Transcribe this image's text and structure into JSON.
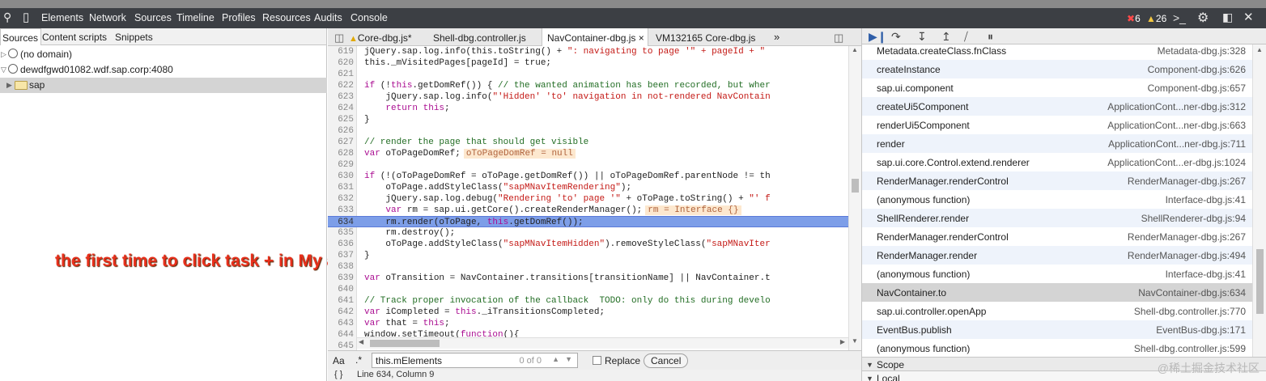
{
  "toolbar": {
    "tabs": [
      "Elements",
      "Network",
      "Sources",
      "Timeline",
      "Profiles",
      "Resources",
      "Audits",
      "Console"
    ],
    "error_count": "6",
    "warning_count": "26"
  },
  "left_panel": {
    "tabs": [
      "Sources",
      "Content scripts",
      "Snippets"
    ],
    "tree": [
      "(no domain)",
      "dewdfgwd01082.wdf.sap.corp:4080",
      "sap"
    ]
  },
  "annotation": "the first time to click task + in My account",
  "editor": {
    "tabs": [
      "Core-dbg.js*",
      "Shell-dbg.controller.js",
      "NavContainer-dbg.js",
      "VM132165 Core-dbg.js"
    ],
    "overflow": "»",
    "close": "×",
    "current_line": "634",
    "lines": [
      {
        "n": "619",
        "parts": [
          {
            "t": "jQuery.sap.log.info(this.toString() + ",
            "c": ""
          },
          {
            "t": "\": navigating to page '\" + pageId + \"",
            "c": "str"
          }
        ]
      },
      {
        "n": "620",
        "parts": [
          {
            "t": "this._mVisitedPages[pageId] = true;",
            "c": ""
          }
        ]
      },
      {
        "n": "621",
        "parts": []
      },
      {
        "n": "622",
        "parts": [
          {
            "t": "if",
            "c": "kw"
          },
          {
            "t": " (!",
            "c": ""
          },
          {
            "t": "this",
            "c": "kw"
          },
          {
            "t": ".getDomRef()) { ",
            "c": ""
          },
          {
            "t": "// the wanted animation has been recorded, but wher",
            "c": "cm"
          }
        ]
      },
      {
        "n": "623",
        "parts": [
          {
            "t": "    jQuery.sap.log.info(",
            "c": ""
          },
          {
            "t": "\"'Hidden' 'to' navigation in not-rendered NavContain",
            "c": "str"
          }
        ]
      },
      {
        "n": "624",
        "parts": [
          {
            "t": "    ",
            "c": ""
          },
          {
            "t": "return this",
            "c": "kw"
          },
          {
            "t": ";",
            "c": ""
          }
        ]
      },
      {
        "n": "625",
        "parts": [
          {
            "t": "}",
            "c": ""
          }
        ]
      },
      {
        "n": "626",
        "parts": []
      },
      {
        "n": "627",
        "parts": [
          {
            "t": "// render the page that should get visible",
            "c": "cm"
          }
        ]
      },
      {
        "n": "628",
        "parts": [
          {
            "t": "var",
            "c": "kw"
          },
          {
            "t": " oToPageDomRef;",
            "c": ""
          },
          {
            "t": "oToPageDomRef = null",
            "c": "val"
          }
        ]
      },
      {
        "n": "629",
        "parts": []
      },
      {
        "n": "630",
        "parts": [
          {
            "t": "if",
            "c": "kw"
          },
          {
            "t": " (!(oToPageDomRef = oToPage.getDomRef()) || oToPageDomRef.parentNode != th",
            "c": ""
          }
        ]
      },
      {
        "n": "631",
        "parts": [
          {
            "t": "    oToPage.addStyleClass(",
            "c": ""
          },
          {
            "t": "\"sapMNavItemRendering\"",
            "c": "str"
          },
          {
            "t": ");",
            "c": ""
          }
        ]
      },
      {
        "n": "632",
        "parts": [
          {
            "t": "    jQuery.sap.log.debug(",
            "c": ""
          },
          {
            "t": "\"Rendering 'to' page '\"",
            "c": "str"
          },
          {
            "t": " + oToPage.toString() + ",
            "c": ""
          },
          {
            "t": "\"' f",
            "c": "str"
          }
        ]
      },
      {
        "n": "633",
        "parts": [
          {
            "t": "    ",
            "c": ""
          },
          {
            "t": "var",
            "c": "kw"
          },
          {
            "t": " rm = sap.ui.getCore().createRenderManager();",
            "c": ""
          },
          {
            "t": "rm = Interface {}",
            "c": "val"
          }
        ]
      },
      {
        "n": "634",
        "parts": [
          {
            "t": "    rm.render(oToPage, ",
            "c": ""
          },
          {
            "t": "this",
            "c": "kw"
          },
          {
            "t": ".getDomRef());",
            "c": ""
          }
        ]
      },
      {
        "n": "635",
        "parts": [
          {
            "t": "    rm.destroy();",
            "c": ""
          }
        ]
      },
      {
        "n": "636",
        "parts": [
          {
            "t": "    oToPage.addStyleClass(",
            "c": ""
          },
          {
            "t": "\"sapMNavItemHidden\"",
            "c": "str"
          },
          {
            "t": ").removeStyleClass(",
            "c": ""
          },
          {
            "t": "\"sapMNavIter",
            "c": "str"
          }
        ]
      },
      {
        "n": "637",
        "parts": [
          {
            "t": "}",
            "c": ""
          }
        ]
      },
      {
        "n": "638",
        "parts": []
      },
      {
        "n": "639",
        "parts": [
          {
            "t": "var",
            "c": "kw"
          },
          {
            "t": " oTransition = NavContainer.transitions[transitionName] || NavContainer.t",
            "c": ""
          }
        ]
      },
      {
        "n": "640",
        "parts": []
      },
      {
        "n": "641",
        "parts": [
          {
            "t": "// Track proper invocation of the callback  TODO: only do this during develo",
            "c": "cm"
          }
        ]
      },
      {
        "n": "642",
        "parts": [
          {
            "t": "var",
            "c": "kw"
          },
          {
            "t": " iCompleted = ",
            "c": ""
          },
          {
            "t": "this",
            "c": "kw"
          },
          {
            "t": "._iTransitionsCompleted;",
            "c": ""
          }
        ]
      },
      {
        "n": "643",
        "parts": [
          {
            "t": "var",
            "c": "kw"
          },
          {
            "t": " that = ",
            "c": ""
          },
          {
            "t": "this",
            "c": "kw"
          },
          {
            "t": ";",
            "c": ""
          }
        ]
      },
      {
        "n": "644",
        "parts": [
          {
            "t": "window.setTimeout(",
            "c": ""
          },
          {
            "t": "function",
            "c": "kw"
          },
          {
            "t": "(){",
            "c": ""
          }
        ]
      },
      {
        "n": "645",
        "parts": []
      }
    ]
  },
  "find": {
    "aa_label": "Aa",
    "regex_label": ".*",
    "query": "this.mElements",
    "count": "0 of 0",
    "replace_label": "Replace",
    "cancel_label": "Cancel"
  },
  "status": {
    "braces": "{ }",
    "position": "Line 634, Column 9"
  },
  "call_stack": [
    {
      "fn": "Metadata.createClass.fnClass",
      "loc": "Metadata-dbg.js:328"
    },
    {
      "fn": "createInstance",
      "loc": "Component-dbg.js:626"
    },
    {
      "fn": "sap.ui.component",
      "loc": "Component-dbg.js:657"
    },
    {
      "fn": "createUi5Component",
      "loc": "ApplicationCont...ner-dbg.js:312"
    },
    {
      "fn": "renderUi5Component",
      "loc": "ApplicationCont...ner-dbg.js:663"
    },
    {
      "fn": "render",
      "loc": "ApplicationCont...ner-dbg.js:711"
    },
    {
      "fn": "sap.ui.core.Control.extend.renderer",
      "loc": "ApplicationCont...er-dbg.js:1024"
    },
    {
      "fn": "RenderManager.renderControl",
      "loc": "RenderManager-dbg.js:267"
    },
    {
      "fn": "(anonymous function)",
      "loc": "Interface-dbg.js:41"
    },
    {
      "fn": "ShellRenderer.render",
      "loc": "ShellRenderer-dbg.js:94"
    },
    {
      "fn": "RenderManager.renderControl",
      "loc": "RenderManager-dbg.js:267"
    },
    {
      "fn": "RenderManager.render",
      "loc": "RenderManager-dbg.js:494"
    },
    {
      "fn": "(anonymous function)",
      "loc": "Interface-dbg.js:41"
    },
    {
      "fn": "NavContainer.to",
      "loc": "NavContainer-dbg.js:634",
      "selected": true
    },
    {
      "fn": "sap.ui.controller.openApp",
      "loc": "Shell-dbg.controller.js:770"
    },
    {
      "fn": "EventBus.publish",
      "loc": "EventBus-dbg.js:171"
    },
    {
      "fn": "(anonymous function)",
      "loc": "Shell-dbg.controller.js:599"
    }
  ],
  "sections": [
    "Scope",
    "Local"
  ],
  "watermark": "@稀土掘金技术社区"
}
